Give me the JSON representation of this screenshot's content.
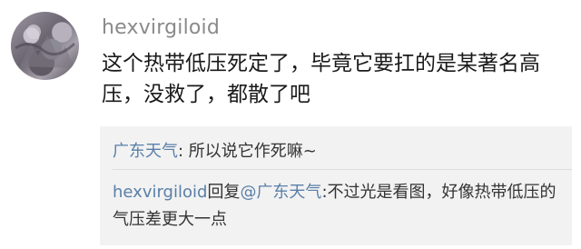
{
  "post": {
    "username": "hexvirgiloid",
    "text": "这个热带低压死定了，毕竟它要扛的是某著名高压，没救了，都散了吧"
  },
  "replies": [
    {
      "author": "广东天气",
      "sep": ": ",
      "text": "所以说它作死嘛~"
    },
    {
      "author": "hexvirgiloid",
      "reply_word": "回复",
      "target": "@广东天气",
      "sep": ":",
      "text": "不过光是看图，好像热带低压的气压差更大一点"
    }
  ],
  "colors": {
    "username": "#8a8a8a",
    "link_name": "#5a7fa8",
    "reply_bg": "#f2f2f2"
  }
}
